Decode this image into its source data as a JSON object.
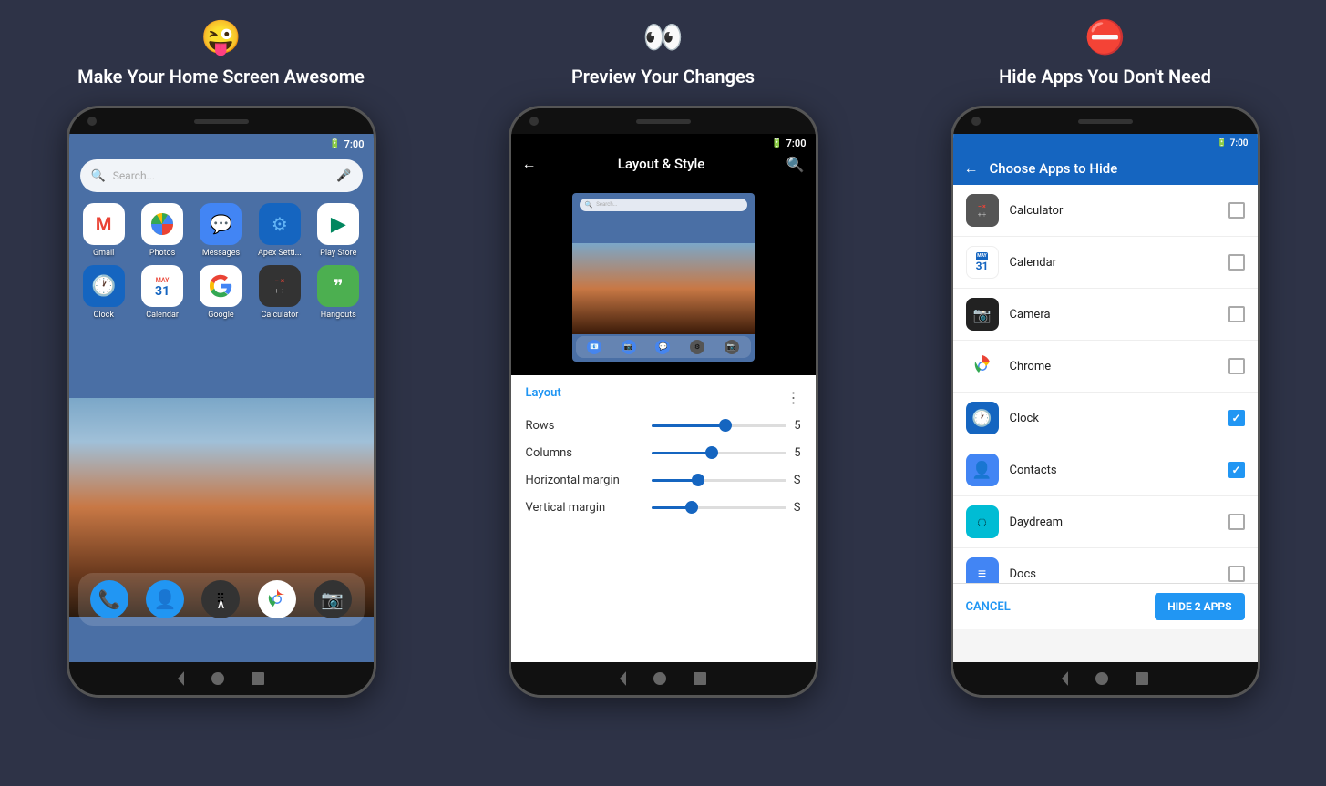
{
  "background_color": "#2e3347",
  "features": [
    {
      "id": "feature1",
      "icon": "😜",
      "title": "Make Your Home Screen Awesome",
      "phone": {
        "status_time": "7:00",
        "search_placeholder": "Search...",
        "apps": [
          {
            "name": "Gmail",
            "icon": "M",
            "bg": "#fff",
            "color": "#ea4335"
          },
          {
            "name": "Photos",
            "icon": "⊕",
            "bg": "#fff"
          },
          {
            "name": "Messages",
            "icon": "💬",
            "bg": "#4285f4"
          },
          {
            "name": "Apex Setti...",
            "icon": "⚙",
            "bg": "#1565c0"
          },
          {
            "name": "Play Store",
            "icon": "▶",
            "bg": "#fff",
            "color": "#01875f"
          },
          {
            "name": "Clock",
            "icon": "🕐",
            "bg": "#1565c0"
          },
          {
            "name": "Calendar",
            "icon": "31",
            "bg": "#fff",
            "color": "#1565c0"
          },
          {
            "name": "Google",
            "icon": "G",
            "bg": "#fff"
          },
          {
            "name": "Calculator",
            "icon": "#",
            "bg": "#444"
          },
          {
            "name": "Hangouts",
            "icon": "❞",
            "bg": "#4caf50"
          }
        ],
        "dock": [
          "📞",
          "👤",
          "⠿",
          "🌐",
          "📷"
        ]
      }
    },
    {
      "id": "feature2",
      "icon": "👀",
      "title": "Preview Your Changes",
      "phone": {
        "status_time": "7:00",
        "back_label": "←",
        "screen_title": "Layout & Style",
        "panel": {
          "section": "Layout",
          "rows": [
            {
              "label": "Rows",
              "value": "5",
              "fill_pct": 55
            },
            {
              "label": "Columns",
              "value": "5",
              "fill_pct": 45
            },
            {
              "label": "Horizontal margin",
              "value": "S",
              "fill_pct": 35
            },
            {
              "label": "Vertical margin",
              "value": "S",
              "fill_pct": 30
            }
          ]
        }
      }
    },
    {
      "id": "feature3",
      "icon": "⛔",
      "title": "Hide Apps You Don't Need",
      "phone": {
        "status_time": "7:00",
        "screen_title": "Choose Apps to Hide",
        "apps": [
          {
            "name": "Calculator",
            "icon": "⊞",
            "checked": false
          },
          {
            "name": "Calendar",
            "icon": "31",
            "checked": false
          },
          {
            "name": "Camera",
            "icon": "📷",
            "checked": false
          },
          {
            "name": "Chrome",
            "icon": "🌐",
            "checked": false
          },
          {
            "name": "Clock",
            "icon": "🕐",
            "checked": true
          },
          {
            "name": "Contacts",
            "icon": "👤",
            "checked": true
          },
          {
            "name": "Daydream",
            "icon": "◌",
            "checked": false
          },
          {
            "name": "Docs",
            "icon": "≡",
            "checked": false
          }
        ],
        "cancel_label": "CANCEL",
        "hide_label": "HIDE 2 APPS"
      }
    }
  ]
}
